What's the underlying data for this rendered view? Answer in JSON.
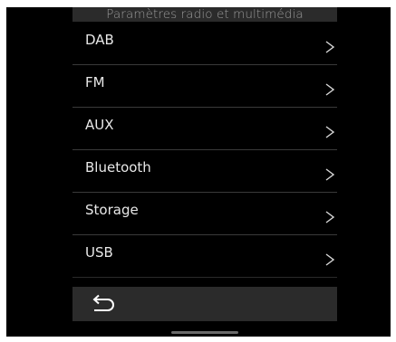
{
  "header": {
    "title": "Paramètres radio et multimédia"
  },
  "menu": {
    "items": [
      {
        "label": "DAB",
        "icon": "chevron-right-icon"
      },
      {
        "label": "FM",
        "icon": "chevron-right-icon"
      },
      {
        "label": "AUX",
        "icon": "chevron-right-icon"
      },
      {
        "label": "Bluetooth",
        "icon": "chevron-right-icon"
      },
      {
        "label": "Storage",
        "icon": "chevron-right-icon"
      },
      {
        "label": "USB",
        "icon": "chevron-right-icon"
      }
    ]
  },
  "footer": {
    "back_icon": "back-arrow-icon"
  },
  "colors": {
    "background": "#000000",
    "bar": "#2b2b2b",
    "divider": "#3a3a3a",
    "text": "#e8e8e8",
    "header_text": "#9a9a9a"
  }
}
